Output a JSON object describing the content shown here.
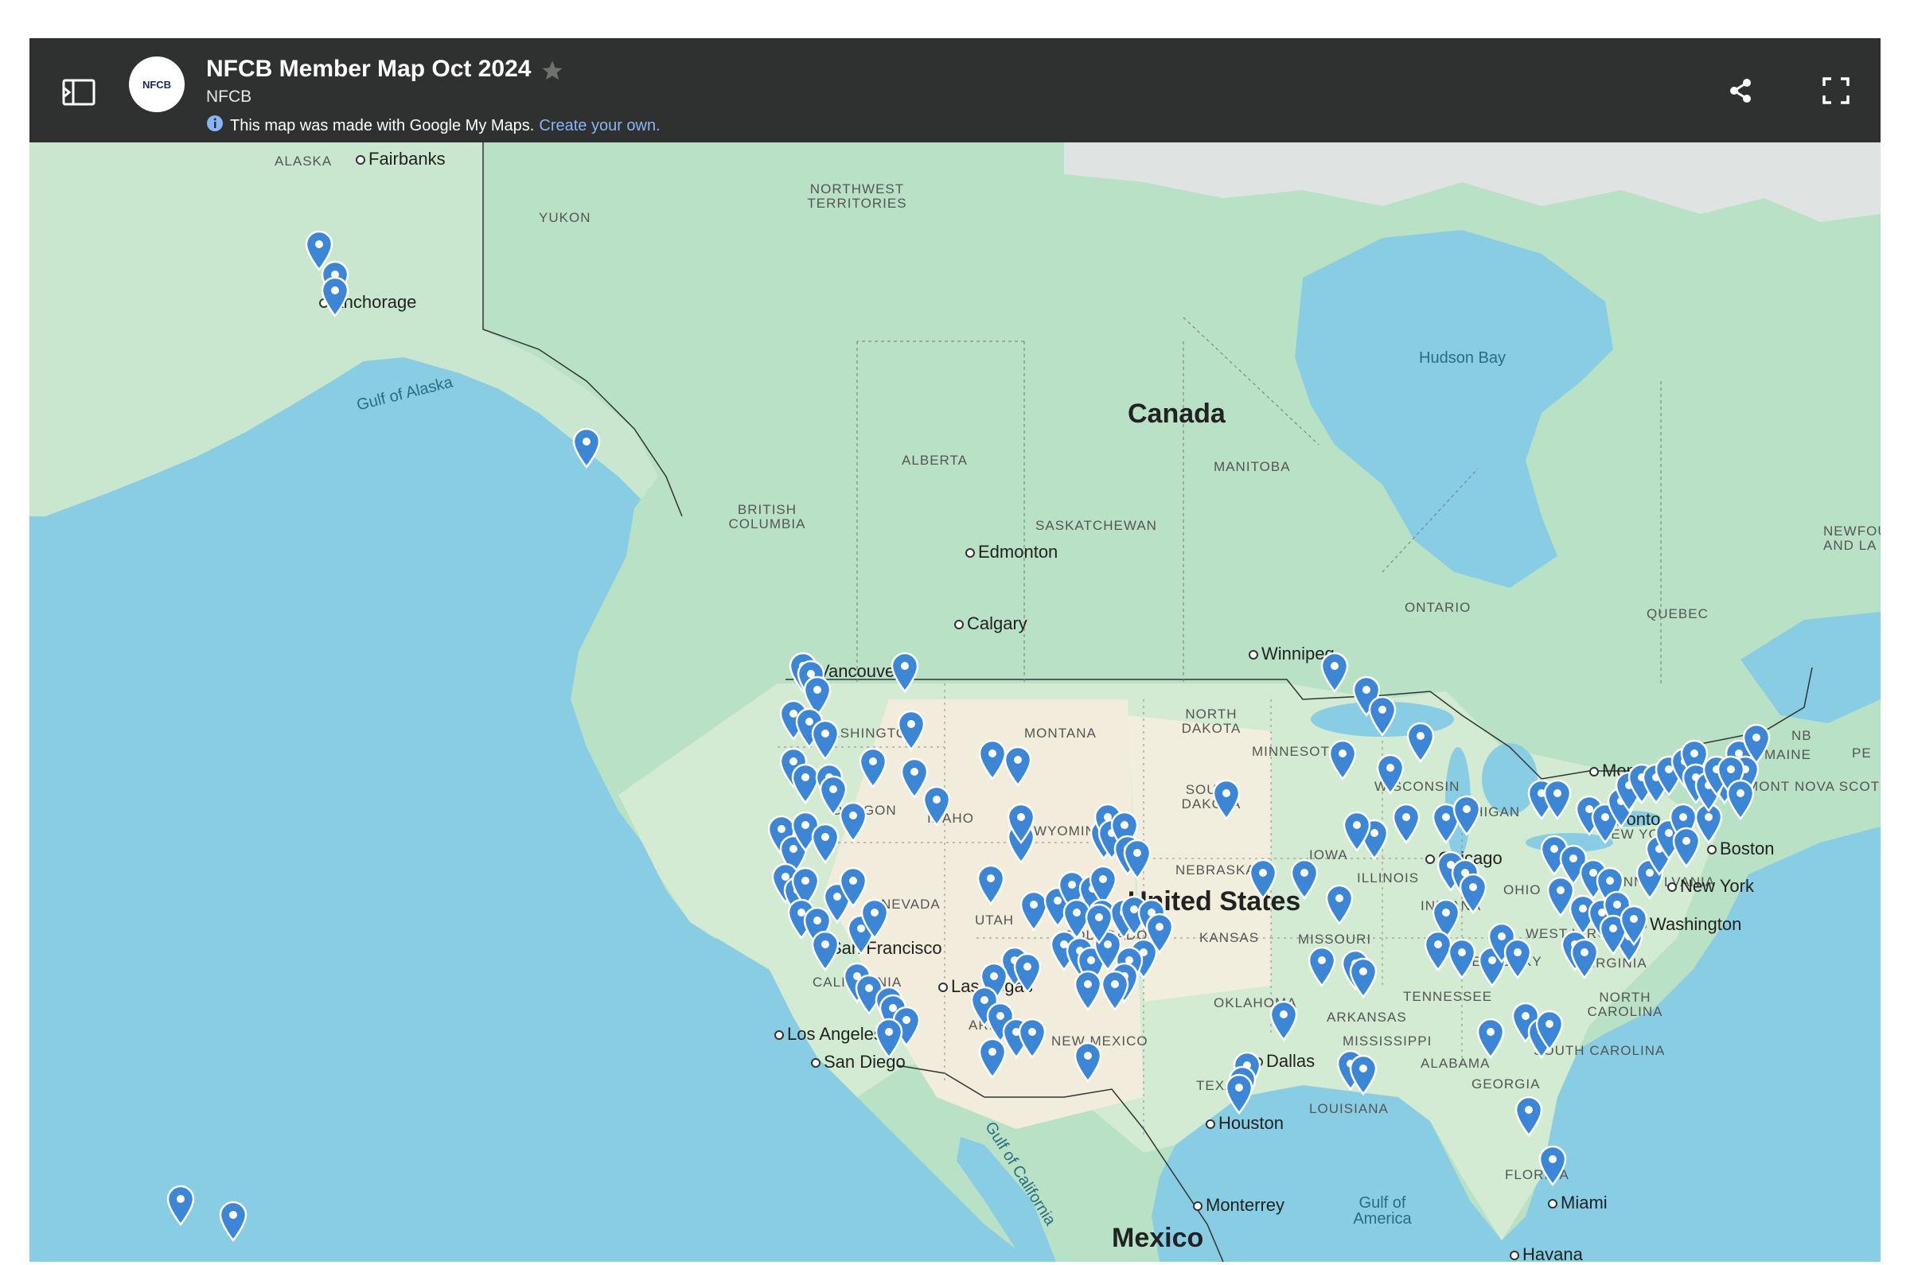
{
  "header": {
    "title": "NFCB Member Map Oct 2024",
    "owner": "NFCB",
    "logo_text": "NFCB",
    "notice_text": "This map was made with Google My Maps.",
    "notice_link": "Create your own.",
    "icons": {
      "sidebar": "sidebar-toggle-icon",
      "star": "star-icon",
      "info": "info-icon",
      "share": "share-icon",
      "fullscreen": "fullscreen-icon"
    }
  },
  "colors": {
    "header_bg": "#2f3130",
    "water": "#88cde3",
    "land_canada": "#b7e2c8",
    "land_us": "#d5ecd3",
    "land_desert": "#f2ecdd",
    "snow": "#e8eef2",
    "marker": "#3d86d6",
    "link": "#8ab4f8"
  },
  "map": {
    "labels": {
      "country": [
        {
          "text": "Canada"
        },
        {
          "text": "United States"
        },
        {
          "text": "Mexico"
        }
      ],
      "region": [
        {
          "text": "ALASKA"
        },
        {
          "text": "YUKON"
        },
        {
          "text": "NORTHWEST TERRITORIES"
        },
        {
          "text": "BRITISH COLUMBIA"
        },
        {
          "text": "ALBERTA"
        },
        {
          "text": "SASKATCHEWAN"
        },
        {
          "text": "MANITOBA"
        },
        {
          "text": "ONTARIO"
        },
        {
          "text": "QUEBEC"
        },
        {
          "text": "NEWFOUNDLAND AND LA"
        },
        {
          "text": "NB"
        },
        {
          "text": "PE"
        },
        {
          "text": "NOVA SCOT"
        },
        {
          "text": "WASHINGTON"
        },
        {
          "text": "OREGON"
        },
        {
          "text": "IDAHO"
        },
        {
          "text": "MONTANA"
        },
        {
          "text": "WYOMING"
        },
        {
          "text": "NEVADA"
        },
        {
          "text": "UTAH"
        },
        {
          "text": "COLORADO"
        },
        {
          "text": "CALIFORNIA"
        },
        {
          "text": "ARIZONA"
        },
        {
          "text": "NEW MEXICO"
        },
        {
          "text": "NORTH DAKOTA"
        },
        {
          "text": "SOUTH DAKOTA"
        },
        {
          "text": "NEBRASKA"
        },
        {
          "text": "KANSAS"
        },
        {
          "text": "OKLAHOMA"
        },
        {
          "text": "TEXAS"
        },
        {
          "text": "MINNESOTA"
        },
        {
          "text": "IOWA"
        },
        {
          "text": "MISSOURI"
        },
        {
          "text": "ARKANSAS"
        },
        {
          "text": "LOUISIANA"
        },
        {
          "text": "WISCONSIN"
        },
        {
          "text": "ILLINOIS"
        },
        {
          "text": "MISSISSIPPI"
        },
        {
          "text": "ALABAMA"
        },
        {
          "text": "TENNESSEE"
        },
        {
          "text": "MICHIGAN"
        },
        {
          "text": "INDIANA"
        },
        {
          "text": "OHIO"
        },
        {
          "text": "KENTUCKY"
        },
        {
          "text": "GEORGIA"
        },
        {
          "text": "FLORIDA"
        },
        {
          "text": "WEST VIRGINIA"
        },
        {
          "text": "VIRGINIA"
        },
        {
          "text": "NORTH CAROLINA"
        },
        {
          "text": "SOUTH CAROLINA"
        },
        {
          "text": "NEW YORK"
        },
        {
          "text": "PENNSYLVANIA"
        },
        {
          "text": "VERMONT"
        },
        {
          "text": "MAINE"
        }
      ],
      "city": [
        {
          "text": "Fairbanks"
        },
        {
          "text": "Anchorage"
        },
        {
          "text": "Edmonton"
        },
        {
          "text": "Calgary"
        },
        {
          "text": "Vancouver"
        },
        {
          "text": "Winnipeg"
        },
        {
          "text": "Montreal"
        },
        {
          "text": "Boston"
        },
        {
          "text": "New York"
        },
        {
          "text": "Washington"
        },
        {
          "text": "Chicago"
        },
        {
          "text": "San Francisco"
        },
        {
          "text": "Las Vegas"
        },
        {
          "text": "Los Angeles"
        },
        {
          "text": "San Diego"
        },
        {
          "text": "Dallas"
        },
        {
          "text": "Houston"
        },
        {
          "text": "Monterrey"
        },
        {
          "text": "Miami"
        },
        {
          "text": "Havana"
        },
        {
          "text": "Toronto"
        }
      ],
      "water": [
        {
          "text": "Gulf of Alaska"
        },
        {
          "text": "Hudson Bay"
        },
        {
          "text": "Gulf of California"
        },
        {
          "text": "Gulf of America"
        }
      ]
    },
    "marker_count": 176
  }
}
